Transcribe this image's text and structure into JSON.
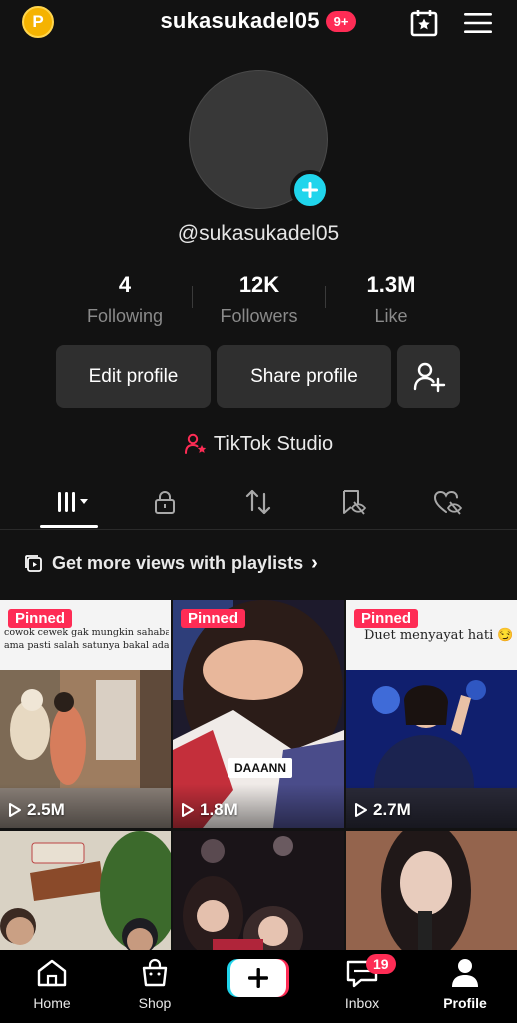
{
  "header": {
    "coin_letter": "P",
    "username": "sukasukadel05",
    "notification_count": "9+"
  },
  "profile": {
    "handle": "@sukasukadel05",
    "stats": [
      {
        "value": "4",
        "label": "Following"
      },
      {
        "value": "12K",
        "label": "Followers"
      },
      {
        "value": "1.3M",
        "label": "Like"
      }
    ],
    "edit_label": "Edit profile",
    "share_label": "Share profile",
    "studio_label": "TikTok Studio"
  },
  "tabs": [
    "videos-grid-icon",
    "lock-icon",
    "repost-icon",
    "saved-icon",
    "liked-icon"
  ],
  "playlist_prompt": "Get more views with playlists",
  "videos": [
    {
      "pinned": "Pinned",
      "views": "2.5M",
      "caption_line1": "cowok cewek gak mungkin sahabatan.",
      "caption_line2": "ama pasti salah satunya bakal ada yang bap"
    },
    {
      "pinned": "Pinned",
      "views": "1.8M",
      "overlay": "DAAANN"
    },
    {
      "pinned": "Pinned",
      "views": "2.7M",
      "caption": "Duet menyayat hati 😏"
    },
    {
      "views": ""
    },
    {
      "views": ""
    },
    {
      "views": ""
    }
  ],
  "nav": {
    "home": "Home",
    "shop": "Shop",
    "inbox": "Inbox",
    "inbox_badge": "19",
    "profile": "Profile"
  },
  "colors": {
    "accent": "#fe2c55",
    "cyan": "#20d5ec",
    "background": "#121212"
  }
}
